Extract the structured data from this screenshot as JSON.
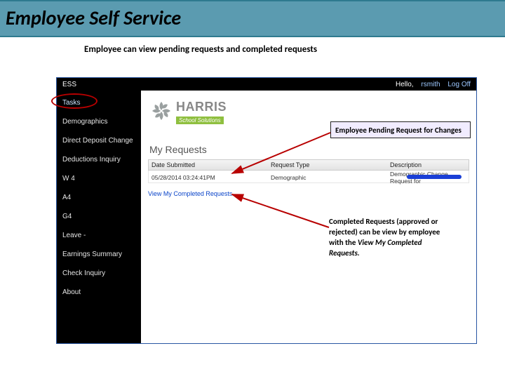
{
  "slide": {
    "title": "Employee Self Service",
    "subtitle": "Employee can view pending requests and completed requests"
  },
  "app": {
    "header": {
      "ess": "ESS",
      "hello_prefix": "Hello,",
      "user": "rsmith",
      "logoff": "Log Off"
    },
    "sidebar": {
      "items": [
        {
          "label": "Tasks"
        },
        {
          "label": "Demographics"
        },
        {
          "label": "Direct Deposit Change"
        },
        {
          "label": "Deductions Inquiry"
        },
        {
          "label": "W 4"
        },
        {
          "label": "A4"
        },
        {
          "label": "G4"
        },
        {
          "label": "Leave -"
        },
        {
          "label": "Earnings Summary"
        },
        {
          "label": "Check Inquiry"
        },
        {
          "label": "About"
        }
      ]
    },
    "brand": {
      "name": "HARRIS",
      "sub": "School Solutions"
    },
    "section_title": "My Requests",
    "grid": {
      "headers": {
        "date": "Date Submitted",
        "type": "Request Type",
        "desc": "Description"
      },
      "rows": [
        {
          "date": "05/28/2014 03:24:41PM",
          "type": "Demographic",
          "desc": "Demographic Change Request for"
        }
      ]
    },
    "link_completed": "View My Completed Requests"
  },
  "annotations": {
    "pending": "Employee Pending Request for Changes",
    "completed_l1": "Completed Requests (approved or rejected) can be view by employee with the ",
    "completed_l2": "View My Completed Requests."
  }
}
